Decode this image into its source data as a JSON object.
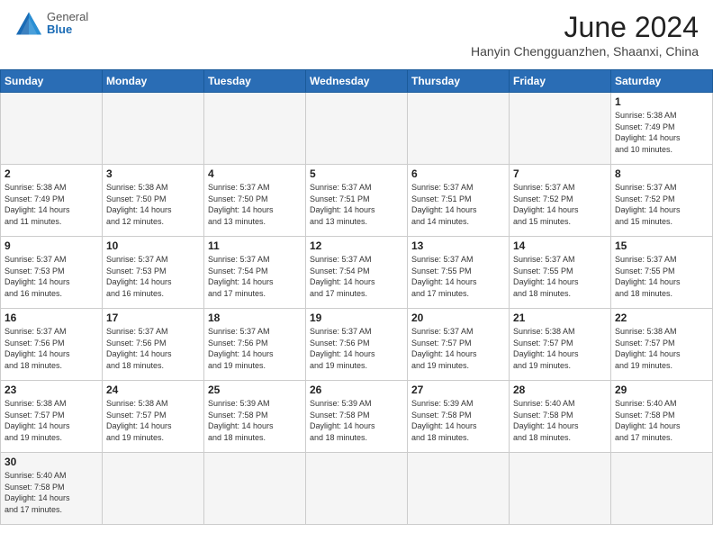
{
  "header": {
    "logo_general": "General",
    "logo_blue": "Blue",
    "month_title": "June 2024",
    "location": "Hanyin Chengguanzhen, Shaanxi, China"
  },
  "days_of_week": [
    "Sunday",
    "Monday",
    "Tuesday",
    "Wednesday",
    "Thursday",
    "Friday",
    "Saturday"
  ],
  "weeks": [
    [
      {
        "day": "",
        "info": ""
      },
      {
        "day": "",
        "info": ""
      },
      {
        "day": "",
        "info": ""
      },
      {
        "day": "",
        "info": ""
      },
      {
        "day": "",
        "info": ""
      },
      {
        "day": "",
        "info": ""
      },
      {
        "day": "1",
        "info": "Sunrise: 5:38 AM\nSunset: 7:49 PM\nDaylight: 14 hours\nand 10 minutes."
      }
    ],
    [
      {
        "day": "2",
        "info": "Sunrise: 5:38 AM\nSunset: 7:49 PM\nDaylight: 14 hours\nand 11 minutes."
      },
      {
        "day": "3",
        "info": "Sunrise: 5:38 AM\nSunset: 7:50 PM\nDaylight: 14 hours\nand 12 minutes."
      },
      {
        "day": "4",
        "info": "Sunrise: 5:37 AM\nSunset: 7:50 PM\nDaylight: 14 hours\nand 13 minutes."
      },
      {
        "day": "5",
        "info": "Sunrise: 5:37 AM\nSunset: 7:51 PM\nDaylight: 14 hours\nand 13 minutes."
      },
      {
        "day": "6",
        "info": "Sunrise: 5:37 AM\nSunset: 7:51 PM\nDaylight: 14 hours\nand 14 minutes."
      },
      {
        "day": "7",
        "info": "Sunrise: 5:37 AM\nSunset: 7:52 PM\nDaylight: 14 hours\nand 15 minutes."
      },
      {
        "day": "8",
        "info": "Sunrise: 5:37 AM\nSunset: 7:52 PM\nDaylight: 14 hours\nand 15 minutes."
      }
    ],
    [
      {
        "day": "9",
        "info": "Sunrise: 5:37 AM\nSunset: 7:53 PM\nDaylight: 14 hours\nand 16 minutes."
      },
      {
        "day": "10",
        "info": "Sunrise: 5:37 AM\nSunset: 7:53 PM\nDaylight: 14 hours\nand 16 minutes."
      },
      {
        "day": "11",
        "info": "Sunrise: 5:37 AM\nSunset: 7:54 PM\nDaylight: 14 hours\nand 17 minutes."
      },
      {
        "day": "12",
        "info": "Sunrise: 5:37 AM\nSunset: 7:54 PM\nDaylight: 14 hours\nand 17 minutes."
      },
      {
        "day": "13",
        "info": "Sunrise: 5:37 AM\nSunset: 7:55 PM\nDaylight: 14 hours\nand 17 minutes."
      },
      {
        "day": "14",
        "info": "Sunrise: 5:37 AM\nSunset: 7:55 PM\nDaylight: 14 hours\nand 18 minutes."
      },
      {
        "day": "15",
        "info": "Sunrise: 5:37 AM\nSunset: 7:55 PM\nDaylight: 14 hours\nand 18 minutes."
      }
    ],
    [
      {
        "day": "16",
        "info": "Sunrise: 5:37 AM\nSunset: 7:56 PM\nDaylight: 14 hours\nand 18 minutes."
      },
      {
        "day": "17",
        "info": "Sunrise: 5:37 AM\nSunset: 7:56 PM\nDaylight: 14 hours\nand 18 minutes."
      },
      {
        "day": "18",
        "info": "Sunrise: 5:37 AM\nSunset: 7:56 PM\nDaylight: 14 hours\nand 19 minutes."
      },
      {
        "day": "19",
        "info": "Sunrise: 5:37 AM\nSunset: 7:56 PM\nDaylight: 14 hours\nand 19 minutes."
      },
      {
        "day": "20",
        "info": "Sunrise: 5:37 AM\nSunset: 7:57 PM\nDaylight: 14 hours\nand 19 minutes."
      },
      {
        "day": "21",
        "info": "Sunrise: 5:38 AM\nSunset: 7:57 PM\nDaylight: 14 hours\nand 19 minutes."
      },
      {
        "day": "22",
        "info": "Sunrise: 5:38 AM\nSunset: 7:57 PM\nDaylight: 14 hours\nand 19 minutes."
      }
    ],
    [
      {
        "day": "23",
        "info": "Sunrise: 5:38 AM\nSunset: 7:57 PM\nDaylight: 14 hours\nand 19 minutes."
      },
      {
        "day": "24",
        "info": "Sunrise: 5:38 AM\nSunset: 7:57 PM\nDaylight: 14 hours\nand 19 minutes."
      },
      {
        "day": "25",
        "info": "Sunrise: 5:39 AM\nSunset: 7:58 PM\nDaylight: 14 hours\nand 18 minutes."
      },
      {
        "day": "26",
        "info": "Sunrise: 5:39 AM\nSunset: 7:58 PM\nDaylight: 14 hours\nand 18 minutes."
      },
      {
        "day": "27",
        "info": "Sunrise: 5:39 AM\nSunset: 7:58 PM\nDaylight: 14 hours\nand 18 minutes."
      },
      {
        "day": "28",
        "info": "Sunrise: 5:40 AM\nSunset: 7:58 PM\nDaylight: 14 hours\nand 18 minutes."
      },
      {
        "day": "29",
        "info": "Sunrise: 5:40 AM\nSunset: 7:58 PM\nDaylight: 14 hours\nand 17 minutes."
      }
    ],
    [
      {
        "day": "30",
        "info": "Sunrise: 5:40 AM\nSunset: 7:58 PM\nDaylight: 14 hours\nand 17 minutes."
      },
      {
        "day": "",
        "info": ""
      },
      {
        "day": "",
        "info": ""
      },
      {
        "day": "",
        "info": ""
      },
      {
        "day": "",
        "info": ""
      },
      {
        "day": "",
        "info": ""
      },
      {
        "day": "",
        "info": ""
      }
    ]
  ]
}
